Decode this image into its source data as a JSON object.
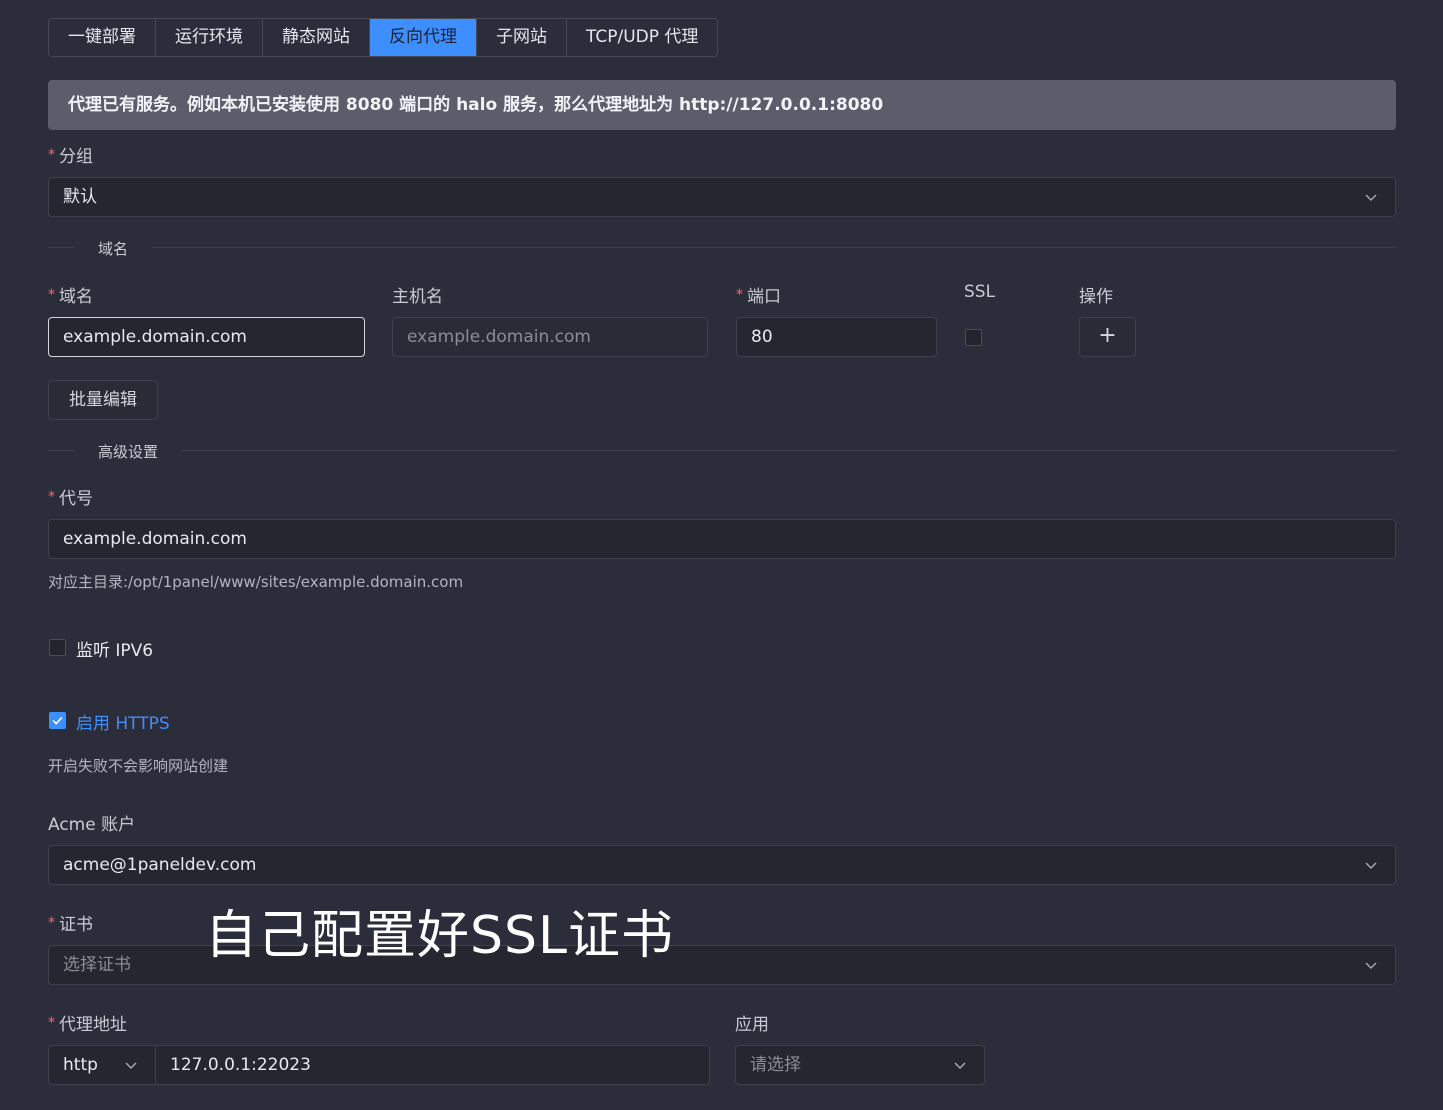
{
  "tabs": [
    "一键部署",
    "运行环境",
    "静态网站",
    "反向代理",
    "子网站",
    "TCP/UDP 代理"
  ],
  "active_tab": "反向代理",
  "alert": "代理已有服务。例如本机已安装使用 8080 端口的 halo 服务，那么代理地址为 http://127.0.0.1:8080",
  "group": {
    "label": "分组",
    "value": "默认"
  },
  "domain_section": {
    "title": "域名",
    "columns": {
      "domain": "域名",
      "host": "主机名",
      "port": "端口",
      "ssl": "SSL",
      "action": "操作"
    },
    "domain_value": "example.domain.com",
    "host_placeholder": "example.domain.com",
    "port_value": "80",
    "add_icon": "+",
    "batch_edit": "批量编辑"
  },
  "advanced": {
    "title": "高级设置",
    "alias_label": "代号",
    "alias_value": "example.domain.com",
    "path_note": "对应主目录:/opt/1panel/www/sites/example.domain.com",
    "ipv6_label": "监听 IPV6",
    "ipv6_checked": false,
    "https_label": "启用 HTTPS",
    "https_checked": true,
    "https_note": "开启失败不会影响网站创建"
  },
  "acme": {
    "label": "Acme 账户",
    "value": "acme@1paneldev.com"
  },
  "cert": {
    "label": "证书",
    "placeholder": "选择证书"
  },
  "proxy": {
    "label": "代理地址",
    "protocol": "http",
    "address": "127.0.0.1:22023"
  },
  "app": {
    "label": "应用",
    "placeholder": "请选择"
  },
  "overlay_text": "自己配置好SSL证书",
  "colors": {
    "accent": "#3d8eff",
    "required": "#f56c6c",
    "background": "#2c2d3a"
  }
}
